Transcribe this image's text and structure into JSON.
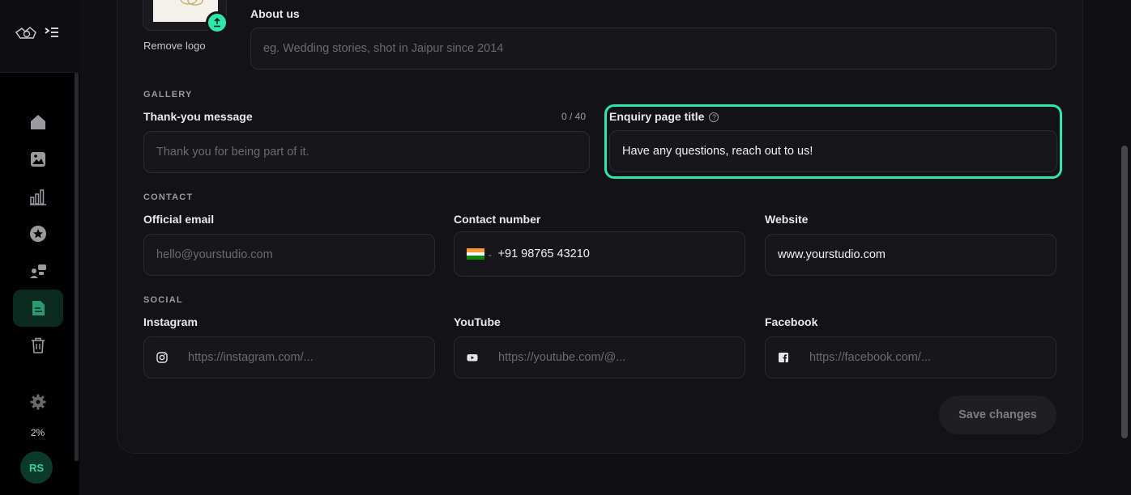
{
  "sidebar": {
    "storage_percent": "2%",
    "avatar_initials": "RS",
    "items": [
      {
        "name": "home",
        "icon": "home-icon"
      },
      {
        "name": "gallery",
        "icon": "image-icon"
      },
      {
        "name": "analytics",
        "icon": "bar-chart-icon"
      },
      {
        "name": "favorites",
        "icon": "star-icon"
      },
      {
        "name": "clients",
        "icon": "users-chat-icon"
      },
      {
        "name": "pages",
        "icon": "document-icon",
        "active": true
      },
      {
        "name": "trash",
        "icon": "trash-icon"
      },
      {
        "name": "settings",
        "icon": "gear-icon"
      }
    ]
  },
  "branding": {
    "remove_logo": "Remove logo"
  },
  "about": {
    "label": "About us",
    "placeholder": "eg. Wedding stories, shot in Jaipur since 2014"
  },
  "gallery": {
    "section": "GALLERY",
    "thankyou_label": "Thank-you message",
    "thankyou_counter": "0 / 40",
    "thankyou_placeholder": "Thank you for being part of it.",
    "enquiry_label": "Enquiry page title",
    "enquiry_value": "Have any questions, reach out to us!"
  },
  "contact": {
    "section": "CONTACT",
    "email_label": "Official email",
    "email_placeholder": "hello@yourstudio.com",
    "phone_label": "Contact number",
    "phone_value": "+91 98765 43210",
    "website_label": "Website",
    "website_value": "www.yourstudio.com"
  },
  "social": {
    "section": "SOCIAL",
    "instagram_label": "Instagram",
    "instagram_placeholder": "https://instagram.com/...",
    "youtube_label": "YouTube",
    "youtube_placeholder": "https://youtube.com/@...",
    "facebook_label": "Facebook",
    "facebook_placeholder": "https://facebook.com/..."
  },
  "actions": {
    "save": "Save changes"
  },
  "colors": {
    "accent": "#2ee8a8",
    "background": "#101013",
    "card": "#131317"
  }
}
